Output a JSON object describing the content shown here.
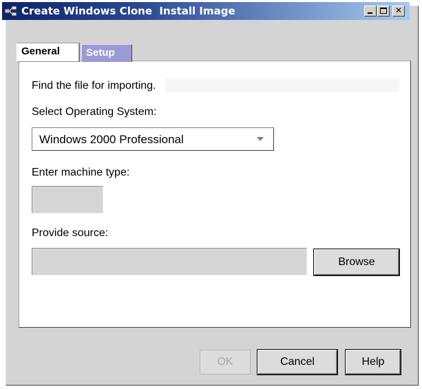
{
  "window": {
    "title": "Create Windows Clone  Install Image"
  },
  "tabs": [
    {
      "label": "General",
      "selected": true
    },
    {
      "label": "Setup",
      "selected": false
    }
  ],
  "form": {
    "instruction": "Find the file for importing.",
    "os_label": "Select Operating System:",
    "os_selected": "Windows 2000 Professional",
    "machine_type_label": "Enter machine type:",
    "machine_type_value": "",
    "source_label": "Provide source:",
    "source_value": "",
    "browse_label": "Browse"
  },
  "footer": {
    "ok_label": "OK",
    "ok_enabled": false,
    "cancel_label": "Cancel",
    "help_label": "Help"
  },
  "colors": {
    "titlebar_start": "#0a246a",
    "titlebar_end": "#a6caf0",
    "setup_tab": "#9b9bd4",
    "window_bg": "#d4d4d4"
  }
}
